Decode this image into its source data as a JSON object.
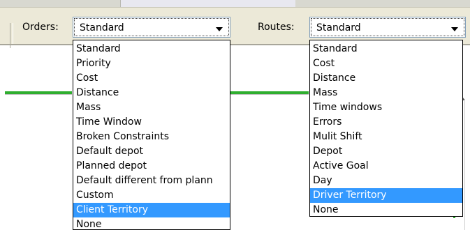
{
  "orders": {
    "label": "Orders:",
    "selected": "Standard",
    "options": [
      "Standard",
      "Priority",
      "Cost",
      "Distance",
      "Mass",
      "Time Window",
      "Broken Constraints",
      "Default depot",
      "Planned depot",
      "Default different from plann",
      "Custom",
      "Client Territory",
      "None"
    ],
    "highlighted": "Client Territory"
  },
  "routes": {
    "label": "Routes:",
    "selected": "Standard",
    "options": [
      "Standard",
      "Cost",
      "Distance",
      "Mass",
      "Time windows",
      "Errors",
      "Mulit Shift",
      "Depot",
      "Active Goal",
      "Day",
      "Driver Territory",
      "None"
    ],
    "highlighted": "Driver Territory"
  },
  "colors": {
    "highlight": "#3399ff",
    "toolbar": "#ece9d8",
    "accent_line": "#2fae2f"
  }
}
